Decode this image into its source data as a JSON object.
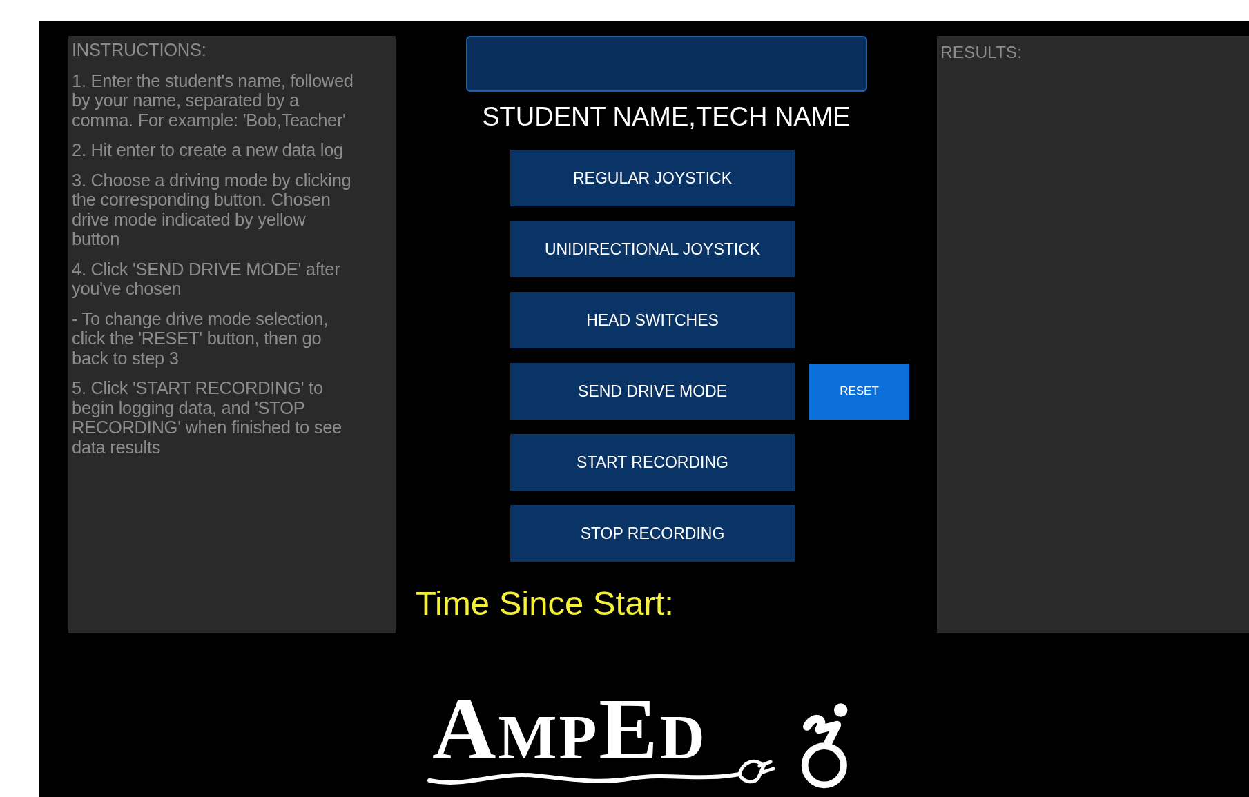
{
  "instructions": {
    "title": "INSTRUCTIONS:",
    "paragraphs": [
      "1. Enter the student's name, followed by your name, separated by a comma. For example: 'Bob,Teacher'",
      "2. Hit enter to create a new data log",
      "3. Choose a driving mode by clicking the corresponding button. Chosen drive mode indicated by yellow button",
      "4. Click 'SEND DRIVE MODE' after you've chosen",
      "- To change drive mode selection, click the 'RESET' button, then go back to step 3",
      "5. Click 'START RECORDING' to begin logging data, and 'STOP RECORDING' when finished to see data results"
    ]
  },
  "name_field": {
    "label": "STUDENT NAME,TECH NAME"
  },
  "buttons": [
    {
      "label": "REGULAR JOYSTICK"
    },
    {
      "label": "UNIDIRECTIONAL JOYSTICK"
    },
    {
      "label": "HEAD SWITCHES"
    },
    {
      "label": "SEND DRIVE MODE",
      "side_button": "RESET"
    },
    {
      "label": "START RECORDING"
    },
    {
      "label": "STOP RECORDING"
    }
  ],
  "timer": {
    "label": "Time Since Start:"
  },
  "results": {
    "title": "RESULTS:"
  },
  "logo": {
    "text": "AmpEd"
  }
}
